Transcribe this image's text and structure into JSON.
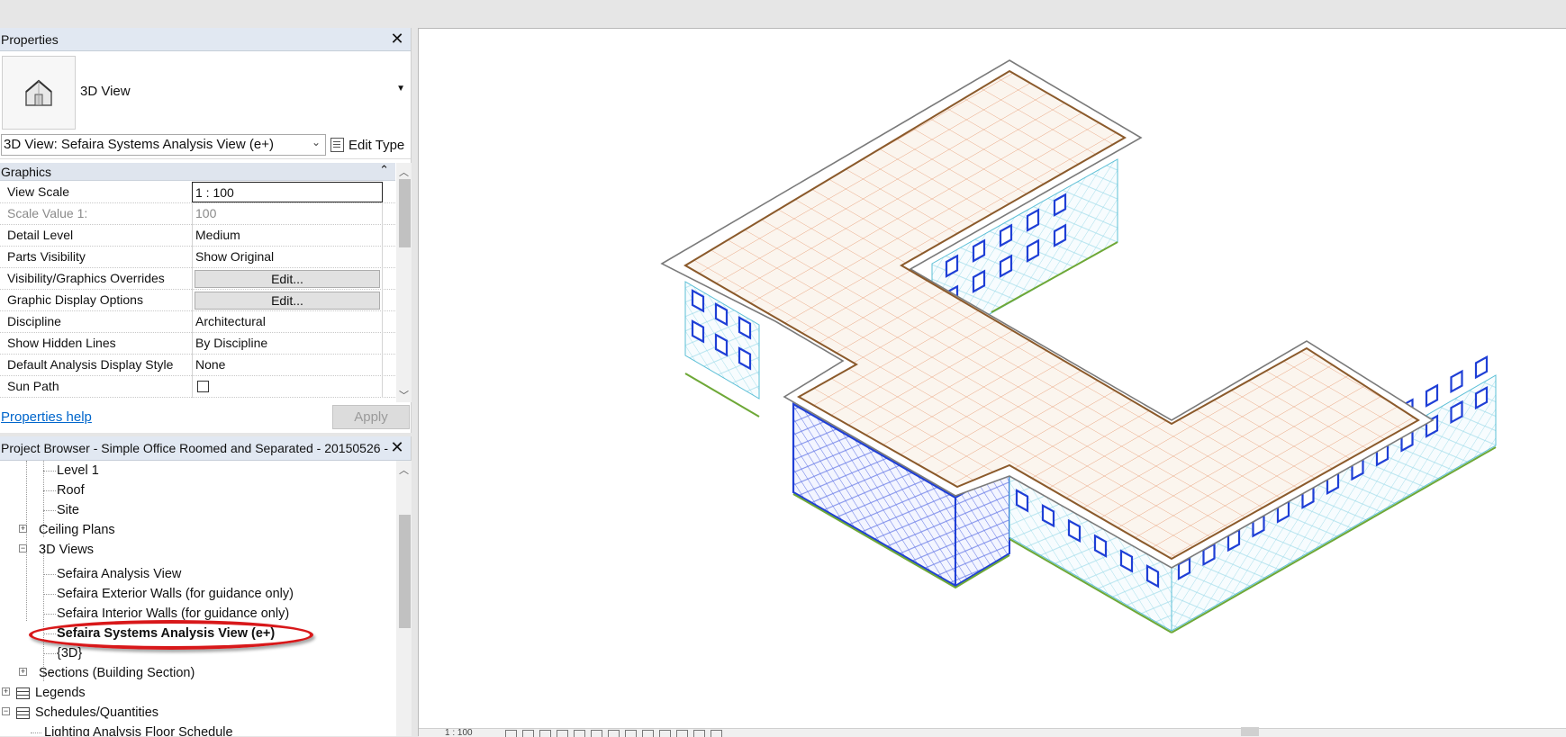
{
  "properties": {
    "title": "Properties",
    "type_name": "3D View",
    "instance_selector": "3D View: Sefaira Systems Analysis View (e+)",
    "edit_type_label": "Edit Type",
    "group": "Graphics",
    "rows": [
      {
        "name": "View Scale",
        "value": "1 : 100"
      },
      {
        "name": "Scale Value    1:",
        "value": "100"
      },
      {
        "name": "Detail Level",
        "value": "Medium"
      },
      {
        "name": "Parts Visibility",
        "value": "Show Original"
      },
      {
        "name": "Visibility/Graphics Overrides",
        "value": "Edit..."
      },
      {
        "name": "Graphic Display Options",
        "value": "Edit..."
      },
      {
        "name": "Discipline",
        "value": "Architectural"
      },
      {
        "name": "Show Hidden Lines",
        "value": "By Discipline"
      },
      {
        "name": "Default Analysis Display Style",
        "value": "None"
      },
      {
        "name": "Sun Path",
        "value": ""
      }
    ],
    "help_link": "Properties help",
    "apply_label": "Apply"
  },
  "browser": {
    "title": "Project Browser - Simple Office Roomed and Separated - 20150526 - ...",
    "items": [
      {
        "label": "Level 1"
      },
      {
        "label": "Roof"
      },
      {
        "label": "Site"
      },
      {
        "label": "Ceiling Plans"
      },
      {
        "label": "3D Views"
      },
      {
        "label": "Sefaira Analysis View"
      },
      {
        "label": "Sefaira Exterior Walls (for guidance only)"
      },
      {
        "label": "Sefaira Interior Walls (for guidance only)"
      },
      {
        "label": "Sefaira Systems Analysis View (e+)"
      },
      {
        "label": "{3D}"
      },
      {
        "label": "Sections (Building Section)"
      },
      {
        "label": "Legends"
      },
      {
        "label": "Schedules/Quantities"
      },
      {
        "label": "Lighting Analysis Floor Schedule"
      }
    ]
  },
  "viewport": {
    "scale_label": "1 : 100"
  },
  "colors": {
    "roof_grid": "#e9a07a",
    "parapet": "#8b5a2b",
    "wall_grid": "#7fd3e8",
    "window": "#1f3fd6",
    "base_line": "#6ea837",
    "highlight": "#d8181a"
  }
}
